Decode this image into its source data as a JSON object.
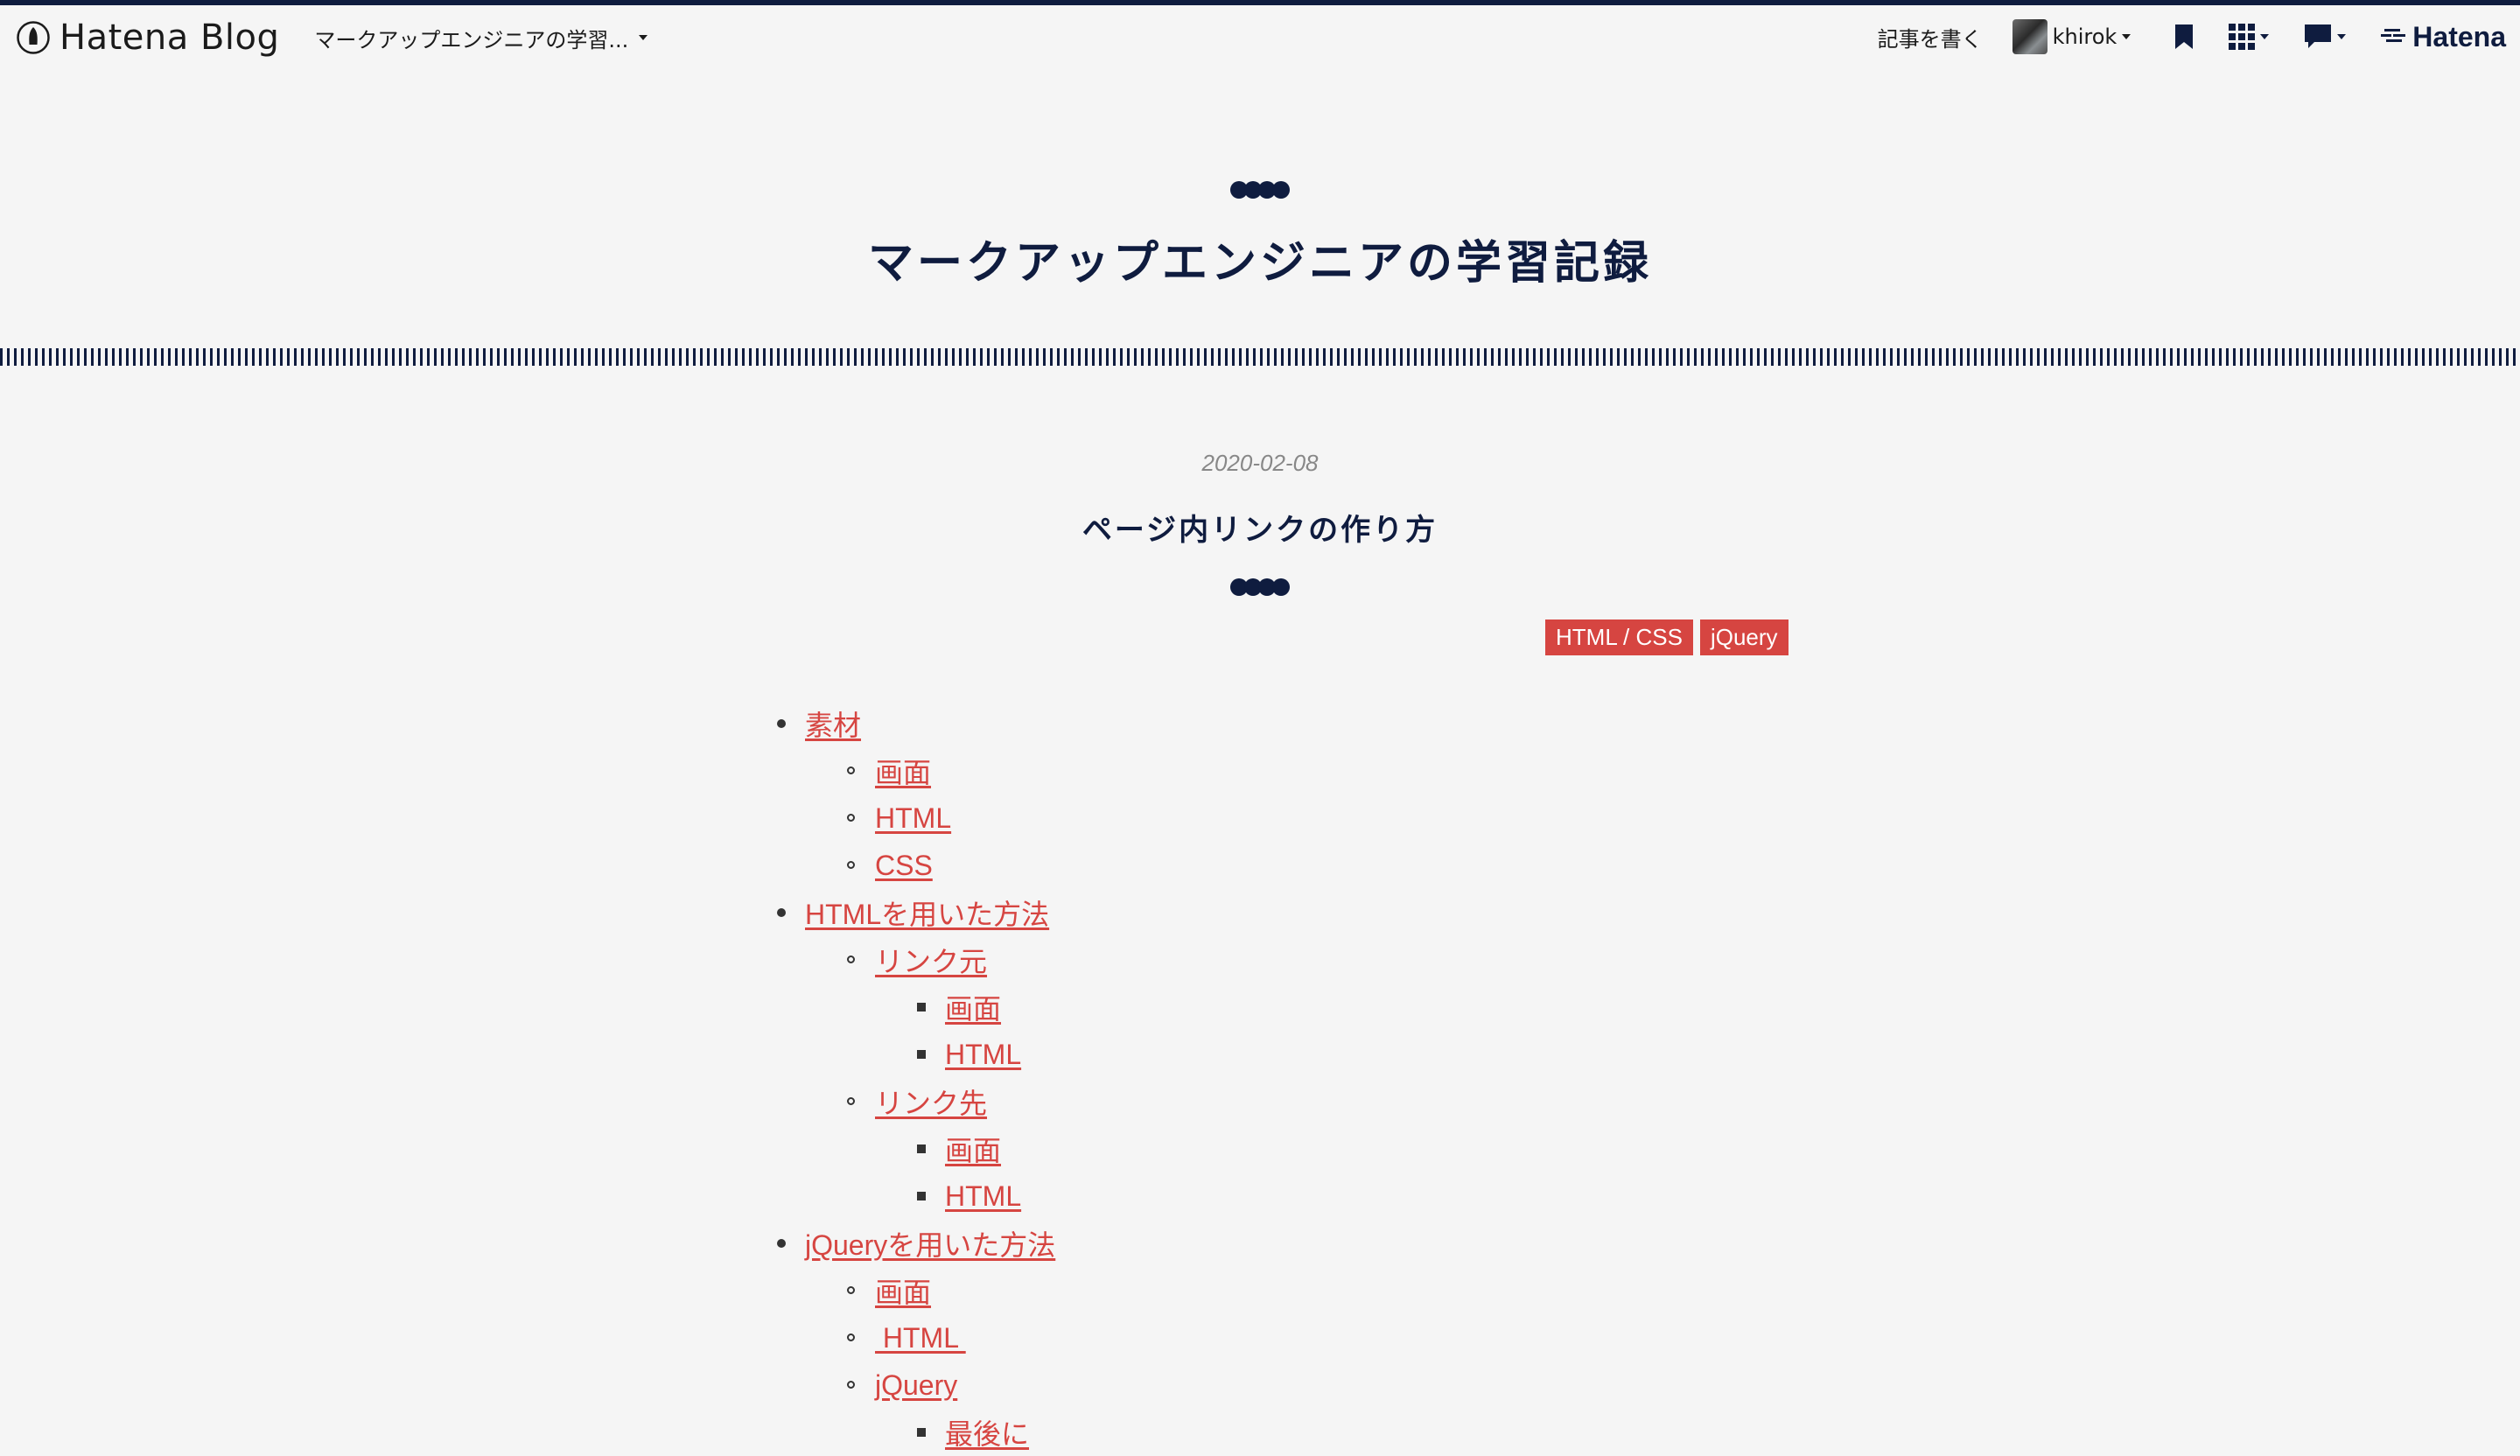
{
  "header": {
    "logo_text": "Hatena Blog",
    "blog_switcher": "マークアップエンジニアの学習...",
    "write_link": "記事を書く",
    "username": "khirok",
    "brand": "Hatena"
  },
  "blog": {
    "title": "マークアップエンジニアの学習記録"
  },
  "entry": {
    "date": "2020-02-08",
    "title": "ページ内リンクの作り方",
    "categories": [
      "HTML / CSS",
      "jQuery"
    ]
  },
  "toc": [
    {
      "label": "素材",
      "level": 1
    },
    {
      "label": "画面",
      "level": 2
    },
    {
      "label": "HTML",
      "level": 2
    },
    {
      "label": "CSS",
      "level": 2
    },
    {
      "label": "HTMLを用いた方法",
      "level": 1
    },
    {
      "label": "リンク元",
      "level": 2
    },
    {
      "label": "画面",
      "level": 3
    },
    {
      "label": "HTML",
      "level": 3
    },
    {
      "label": "リンク先",
      "level": 2
    },
    {
      "label": "画面",
      "level": 3
    },
    {
      "label": "HTML",
      "level": 3
    },
    {
      "label": "jQueryを用いた方法",
      "level": 1
    },
    {
      "label": "画面",
      "level": 2
    },
    {
      "label": " HTML ",
      "level": 2
    },
    {
      "label": "jQuery",
      "level": 2
    },
    {
      "label": "最後に",
      "level": 3
    }
  ],
  "colors": {
    "navy": "#0f1c3f",
    "accent": "#d64541",
    "background": "#f5f5f5"
  },
  "icons": [
    "hatena-blog-logo-icon",
    "bookmark-icon",
    "apps-grid-icon",
    "notification-comment-icon",
    "hatena-logo-icon"
  ]
}
